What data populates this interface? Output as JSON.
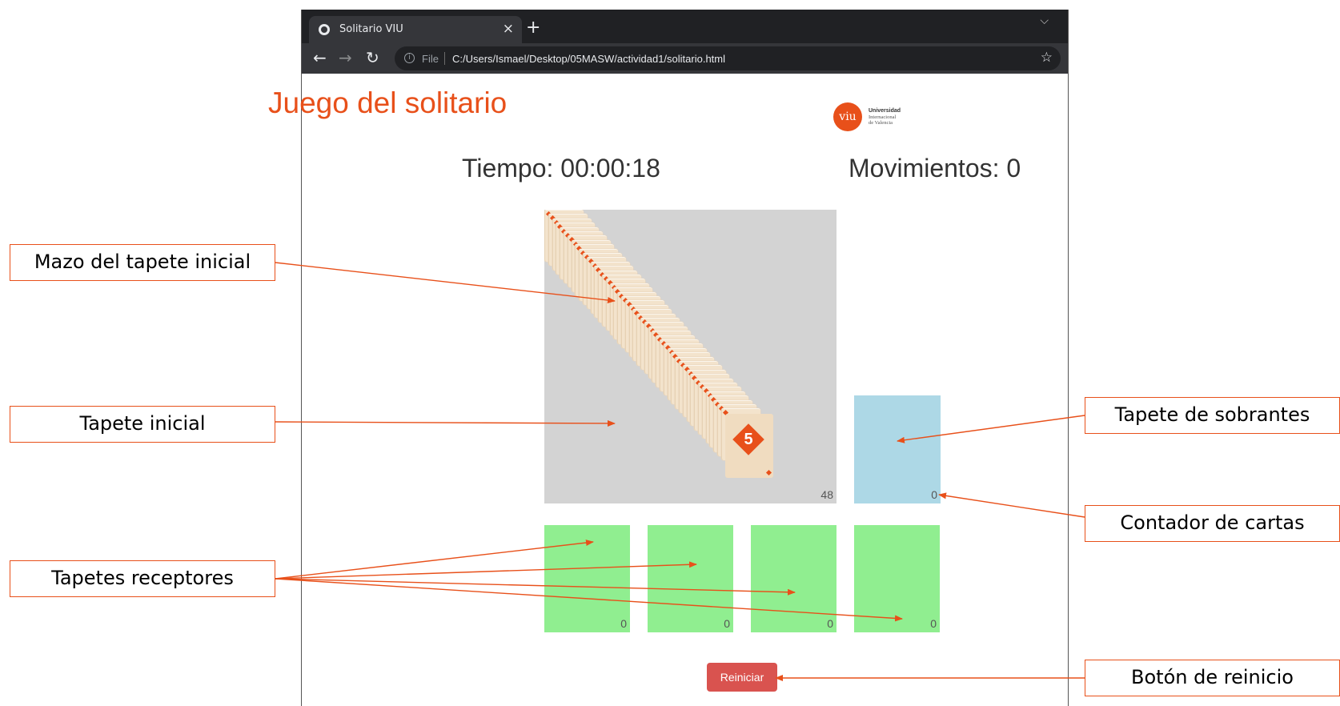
{
  "browser": {
    "tab_title": "Solitario VIU",
    "tab_close": "×",
    "new_tab": "+",
    "tab_menu": "⌵",
    "back": "←",
    "forward": "→",
    "reload": "↻",
    "info": "i",
    "file_label": "File",
    "url": "C:/Users/Ismael/Desktop/05MASW/actividad1/solitario.html",
    "star": "☆"
  },
  "page": {
    "title": "Juego del solitario",
    "logo": {
      "mark": "viu",
      "line1": "Universidad",
      "line2": "Internacional",
      "line3": "de Valencia"
    },
    "timer": "Tiempo: 00:00:18",
    "moves": "Movimientos: 0",
    "initial_mat": {
      "count": "48",
      "top_card_rank": "5"
    },
    "surplus_mat": {
      "count": "0"
    },
    "receiver_mats": [
      {
        "count": "0"
      },
      {
        "count": "0"
      },
      {
        "count": "0"
      },
      {
        "count": "0"
      }
    ],
    "reset_label": "Reiniciar"
  },
  "annotations": {
    "deck": "Mazo del tapete inicial",
    "initial_mat": "Tapete inicial",
    "receivers": "Tapetes receptores",
    "surplus": "Tapete de sobrantes",
    "counter": "Contador de cartas",
    "reset": "Botón de reinicio"
  },
  "colors": {
    "accent": "#e8501a",
    "initial_mat": "#d3d3d3",
    "surplus_mat": "#add8e6",
    "receiver_mat": "#90ee90",
    "reset_button": "#d9534f"
  }
}
